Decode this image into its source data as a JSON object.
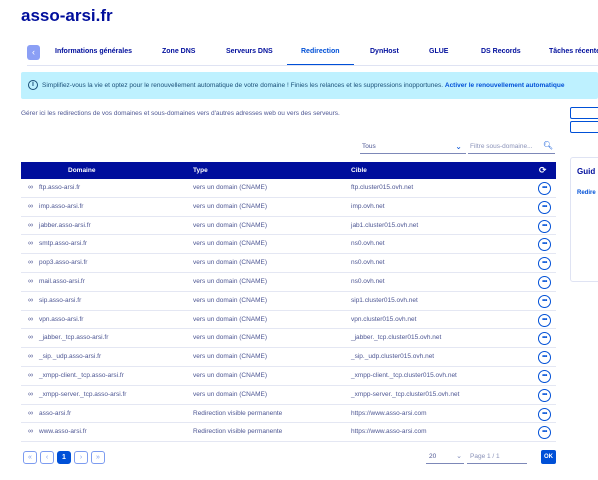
{
  "page": {
    "title": "asso-arsi.fr"
  },
  "tabs": [
    {
      "label": "Informations générales"
    },
    {
      "label": "Zone DNS"
    },
    {
      "label": "Serveurs DNS"
    },
    {
      "label": "Redirection",
      "active": true
    },
    {
      "label": "DynHost"
    },
    {
      "label": "GLUE"
    },
    {
      "label": "DS Records"
    },
    {
      "label": "Tâches récentes"
    }
  ],
  "banner": {
    "icon": "info-icon",
    "text": "Simplifiez-vous la vie et optez pour le renouvellement automatique de votre domaine ! Finies les relances et les suppressions inopportunes.",
    "link": "Activer le renouvellement automatique"
  },
  "intro": "Gérer ici les redirections de vos domaines et sous-domaines vers d'autres adresses web ou vers des serveurs.",
  "filters": {
    "type_selected": "Tous",
    "search_placeholder": "Filtre sous-domaine..."
  },
  "table": {
    "columns": {
      "domain": "Domaine",
      "type": "Type",
      "target": "Cible"
    },
    "rows": [
      {
        "domain": "ftp.asso-arsi.fr",
        "type": "vers un domain (CNAME)",
        "target": "ftp.cluster015.ovh.net"
      },
      {
        "domain": "imp.asso-arsi.fr",
        "type": "vers un domain (CNAME)",
        "target": "imp.ovh.net"
      },
      {
        "domain": "jabber.asso-arsi.fr",
        "type": "vers un domain (CNAME)",
        "target": "jab1.cluster015.ovh.net"
      },
      {
        "domain": "smtp.asso-arsi.fr",
        "type": "vers un domain (CNAME)",
        "target": "ns0.ovh.net"
      },
      {
        "domain": "pop3.asso-arsi.fr",
        "type": "vers un domain (CNAME)",
        "target": "ns0.ovh.net"
      },
      {
        "domain": "mail.asso-arsi.fr",
        "type": "vers un domain (CNAME)",
        "target": "ns0.ovh.net"
      },
      {
        "domain": "sip.asso-arsi.fr",
        "type": "vers un domain (CNAME)",
        "target": "sip1.cluster015.ovh.net"
      },
      {
        "domain": "vpn.asso-arsi.fr",
        "type": "vers un domain (CNAME)",
        "target": "vpn.cluster015.ovh.net"
      },
      {
        "domain": "_jabber._tcp.asso-arsi.fr",
        "type": "vers un domain (CNAME)",
        "target": "_jabber._tcp.cluster015.ovh.net"
      },
      {
        "domain": "_sip._udp.asso-arsi.fr",
        "type": "vers un domain (CNAME)",
        "target": "_sip._udp.cluster015.ovh.net"
      },
      {
        "domain": "_xmpp-client._tcp.asso-arsi.fr",
        "type": "vers un domain (CNAME)",
        "target": "_xmpp-client._tcp.cluster015.ovh.net"
      },
      {
        "domain": "_xmpp-server._tcp.asso-arsi.fr",
        "type": "vers un domain (CNAME)",
        "target": "_xmpp-server._tcp.cluster015.ovh.net"
      },
      {
        "domain": "asso-arsi.fr",
        "type": "Redirection visible permanente",
        "target": "https://www.asso-arsi.com"
      },
      {
        "domain": "www.asso-arsi.fr",
        "type": "Redirection visible permanente",
        "target": "https://www.asso-arsi.com"
      }
    ]
  },
  "guide": {
    "title": "Guid",
    "link": "Redire"
  },
  "pagination": {
    "first": "«",
    "prev": "‹",
    "current": "1",
    "next": "›",
    "last": "»",
    "page_size": "20",
    "page_of": "Page 1 / 1",
    "ok": "OK"
  },
  "colors": {
    "brand_dark": "#000e9c",
    "accent": "#0050d7",
    "banner_bg": "#bef1ff"
  }
}
